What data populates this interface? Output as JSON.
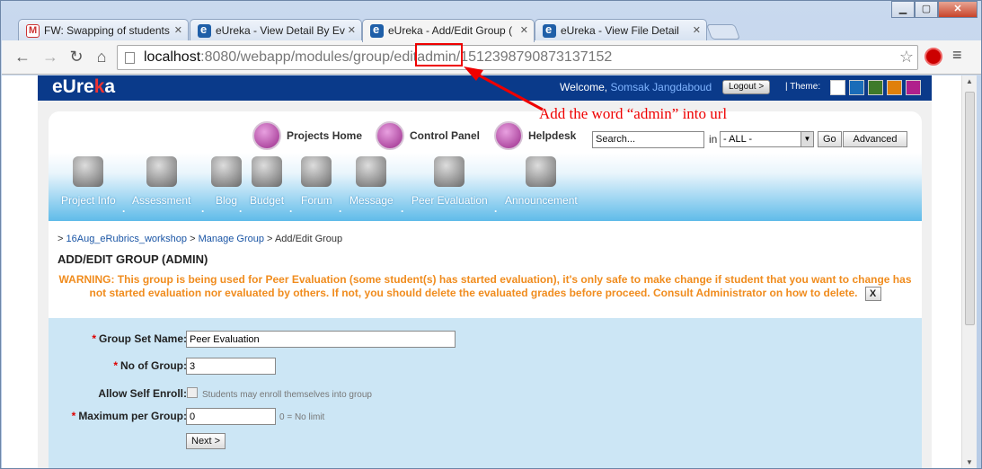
{
  "browser": {
    "tabs": [
      {
        "title": "FW: Swapping of students",
        "icon": "gmail-icon",
        "active": false
      },
      {
        "title": "eUreka - View Detail By Ev",
        "icon": "eureka-icon",
        "active": false
      },
      {
        "title": "eUreka - Add/Edit Group (",
        "icon": "eureka-icon",
        "active": true
      },
      {
        "title": "eUreka - View File Detail",
        "icon": "eureka-icon",
        "active": false
      }
    ],
    "url_host": "localhost",
    "url_rest": ":8080/webapp/modules/group/edit",
    "url_highlight": "admin",
    "url_tail": "/1512398790873137152"
  },
  "site": {
    "logo_main": "eUre",
    "logo_k": "k",
    "logo_end": "a",
    "welcome_label": "Welcome,",
    "user_name": "Somsak Jangdaboud",
    "logout_label": "Logout >",
    "theme_label": "| Theme:",
    "theme_colors": [
      "#ffffff",
      "#1a6cb8",
      "#3f7a2a",
      "#e0800c",
      "#b0208c"
    ]
  },
  "topnav": {
    "projects_home": "Projects Home",
    "control_panel": "Control Panel",
    "helpdesk": "Helpdesk",
    "search_value": "Search...",
    "in_label": "in",
    "scope_value": "- ALL -",
    "go_label": "Go",
    "advanced_label": "Advanced"
  },
  "menu": {
    "items": [
      "Project Info",
      "Assessment",
      "Blog",
      "Budget",
      "Forum",
      "Message",
      "Peer Evaluation",
      "Announcement"
    ],
    "separator": "."
  },
  "breadcrumb": {
    "prefix": ">",
    "course": "16Aug_eRubrics_workshop",
    "sep1": ">",
    "manage": "Manage Group",
    "sep2": ">",
    "current": "Add/Edit Group"
  },
  "page_title": "ADD/EDIT GROUP (ADMIN)",
  "warning": {
    "text": "WARNING: This group is being used for Peer Evaluation (some student(s) has started evaluation), it's only safe to make change if student that you want to change has not started evaluation nor evaluated by others. If not, you should delete the evaluated grades before proceed. Consult Administrator on how to delete.",
    "close_label": "X"
  },
  "form": {
    "required_mark": "*",
    "group_set_name_label": "Group Set Name:",
    "group_set_name_value": "Peer Evaluation",
    "no_of_group_label": "No of Group:",
    "no_of_group_value": "3",
    "allow_self_enroll_label": "Allow Self Enroll:",
    "allow_self_enroll_hint": "Students may enroll themselves into group",
    "max_per_group_label": "Maximum per Group:",
    "max_per_group_value": "0",
    "max_per_group_hint": "0 = No limit",
    "next_label": "Next >"
  },
  "annotation": {
    "text": "Add the word “admin” into url",
    "color": "#e00000"
  }
}
